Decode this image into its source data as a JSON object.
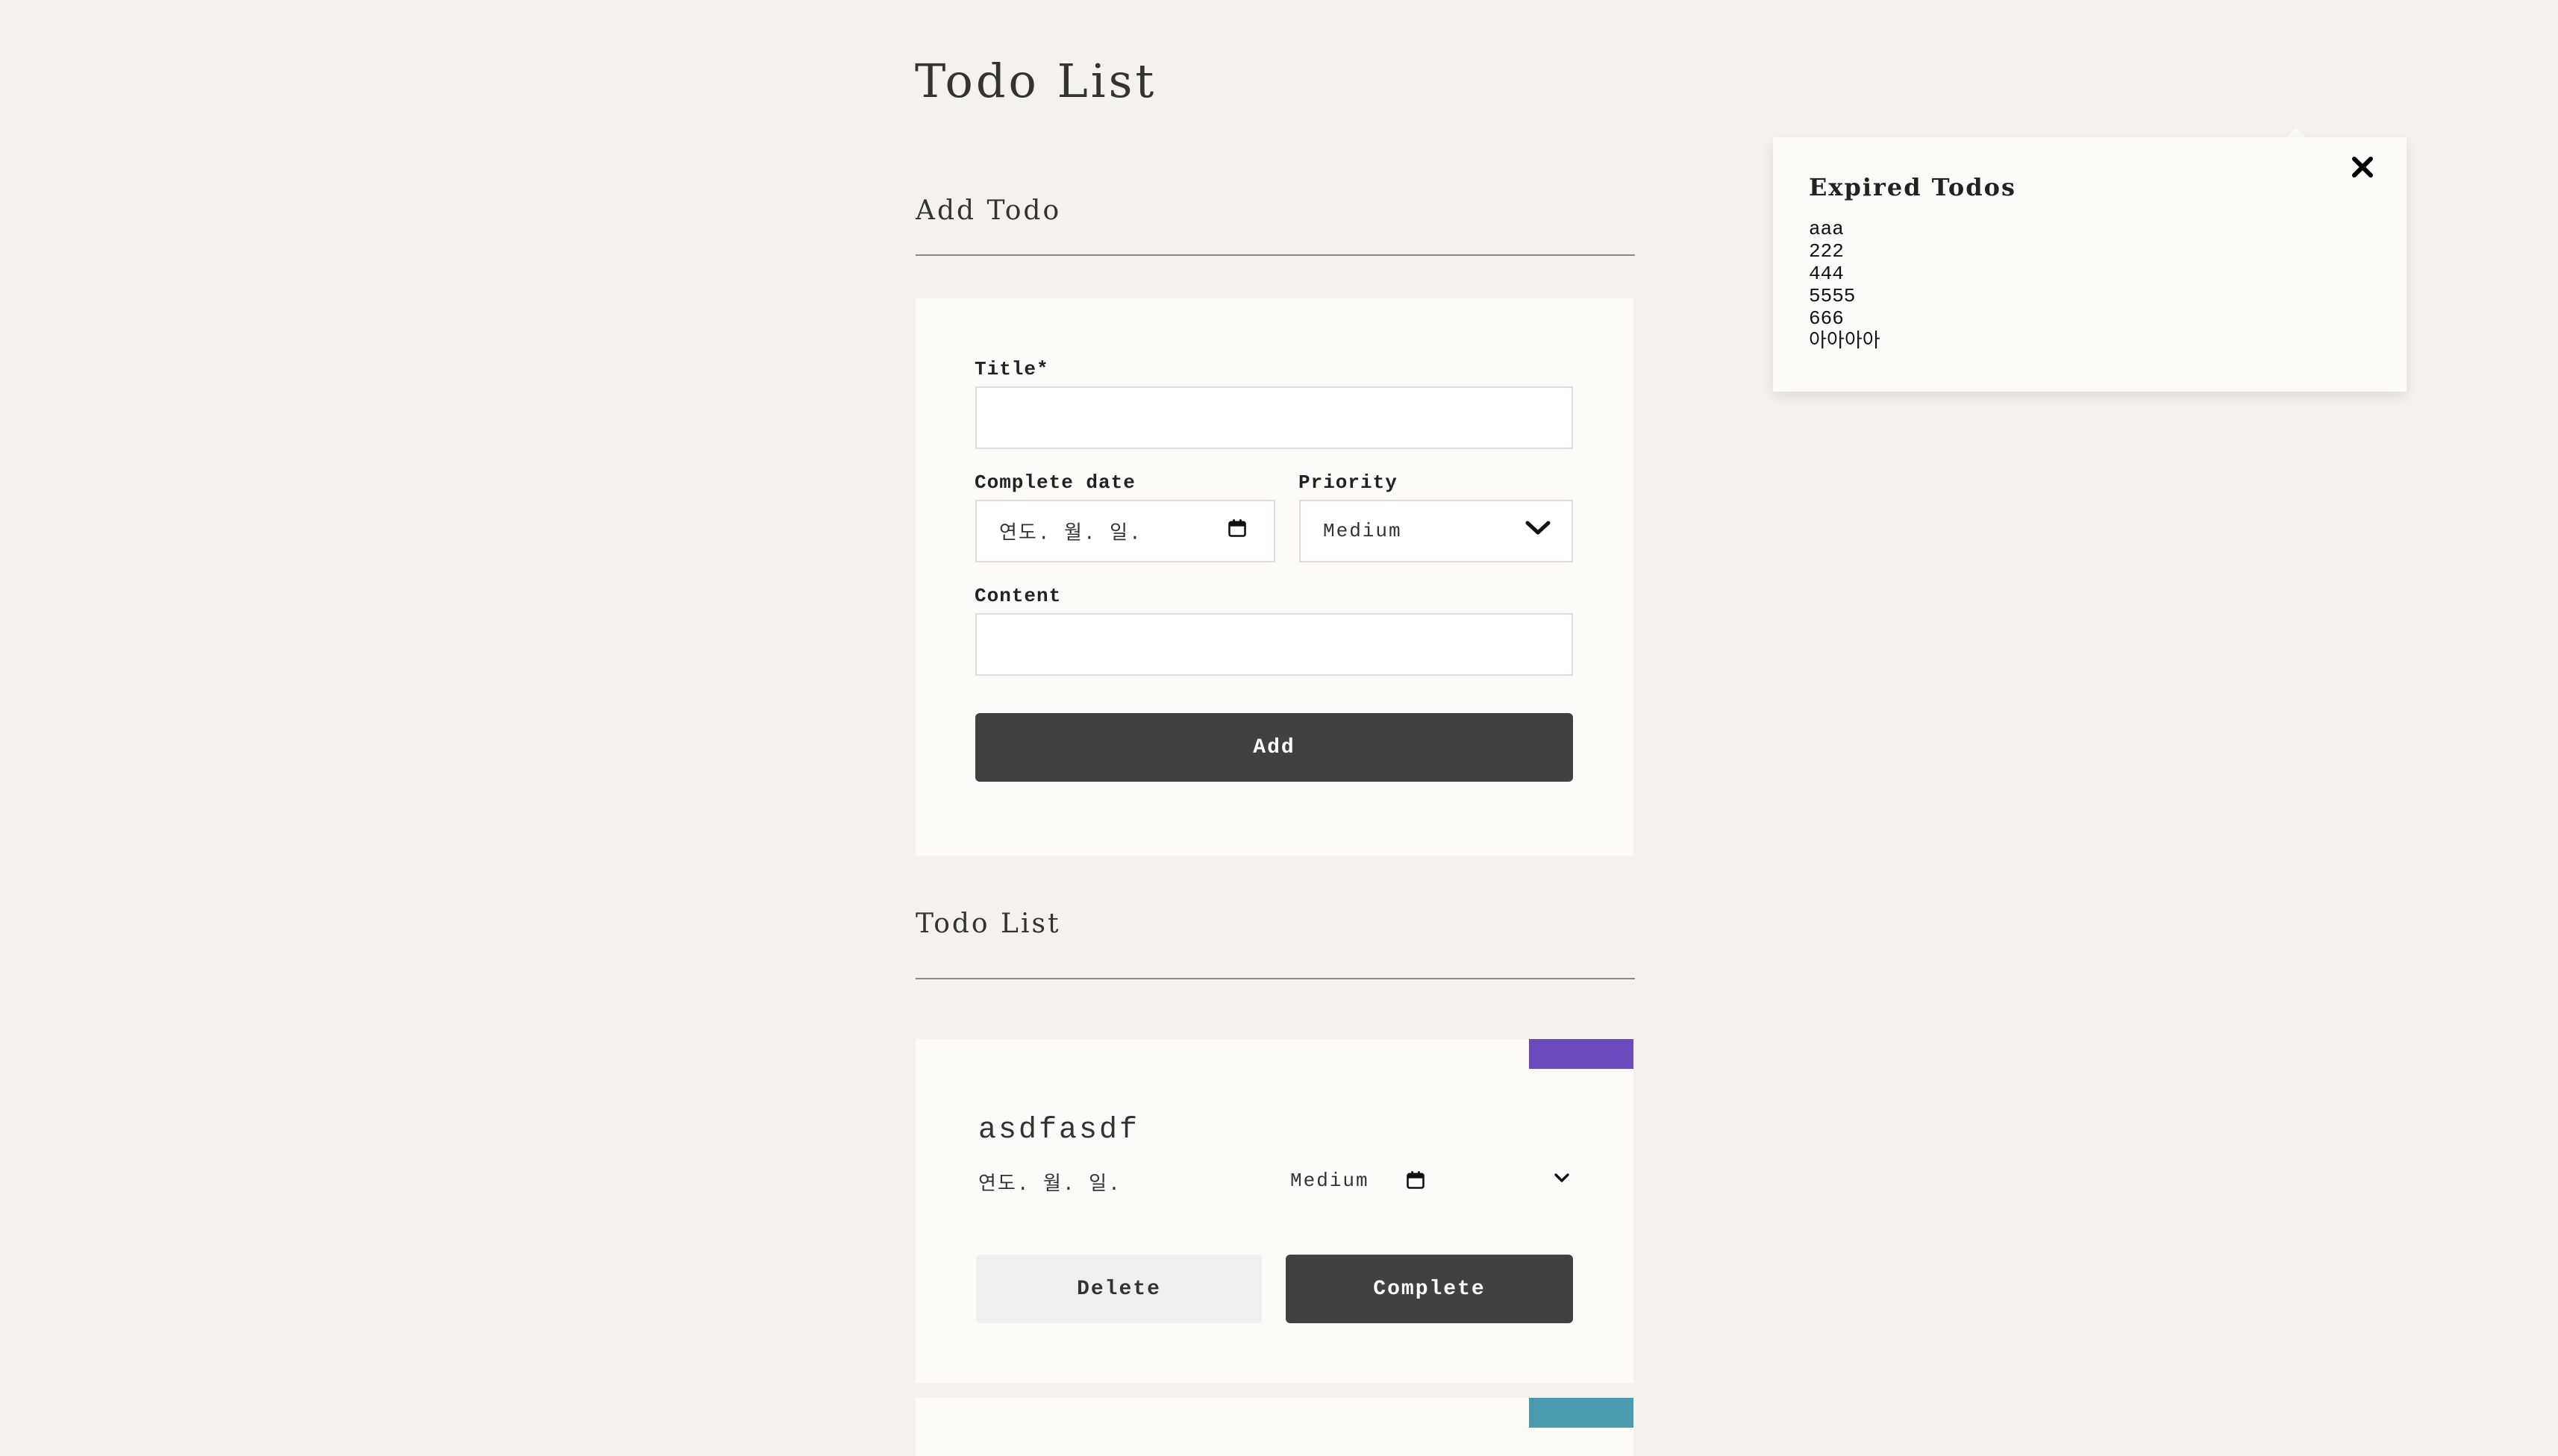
{
  "page": {
    "title": "Todo List"
  },
  "add_section": {
    "heading": "Add Todo",
    "title_label": "Title*",
    "title_value": "",
    "date_label": "Complete date",
    "date_placeholder": "연도. 월. 일.",
    "priority_label": "Priority",
    "priority_value": "Medium",
    "content_label": "Content",
    "content_value": "",
    "add_button": "Add"
  },
  "list_section": {
    "heading": "Todo List",
    "items": [
      {
        "title": "asdfasdf",
        "date_placeholder": "연도. 월. 일.",
        "priority": "Medium",
        "badge_color": "#6b4bbd",
        "delete_label": "Delete",
        "complete_label": "Complete"
      },
      {
        "badge_color": "#4a9bb0"
      }
    ]
  },
  "expired_popup": {
    "title": "Expired Todos",
    "items": [
      "aaa",
      "222",
      "444",
      "5555",
      "666",
      "아아아아"
    ],
    "close_icon": "close-icon"
  }
}
